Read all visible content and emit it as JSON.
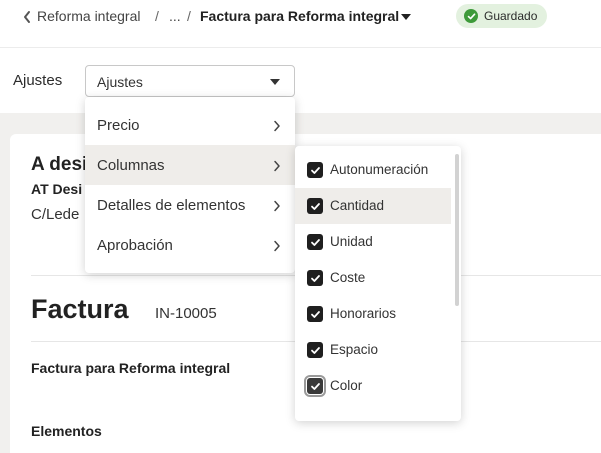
{
  "breadcrumb": {
    "parent": "Reforma integral",
    "sep": "/",
    "ellipsis": "...",
    "current": "Factura para Reforma integral"
  },
  "status": {
    "label": "Guardado",
    "color": "#3e9a3a"
  },
  "settings": {
    "label": "Ajustes",
    "select_value": "Ajustes",
    "menu": [
      {
        "label": "Precio"
      },
      {
        "label": "Columnas",
        "active": true
      },
      {
        "label": "Detalles de elementos"
      },
      {
        "label": "Aprobación"
      }
    ],
    "columns_submenu": [
      {
        "label": "Autonumeración",
        "checked": true
      },
      {
        "label": "Cantidad",
        "checked": true
      },
      {
        "label": "Unidad",
        "checked": true
      },
      {
        "label": "Coste",
        "checked": true
      },
      {
        "label": "Honorarios",
        "checked": true
      },
      {
        "label": "Espacio",
        "checked": true
      },
      {
        "label": "Color",
        "checked": true
      }
    ]
  },
  "document": {
    "recipient_name": "A desi",
    "recipient_company": "AT Desi",
    "recipient_street": "C/Lede",
    "title": "Factura",
    "number": "IN-10005",
    "project": "Factura para Reforma integral",
    "elements_heading": "Elementos"
  }
}
